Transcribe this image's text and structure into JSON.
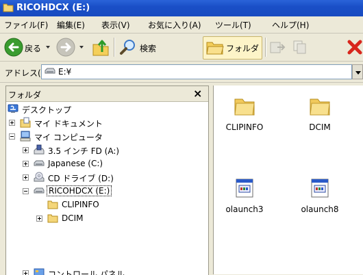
{
  "window": {
    "title": "RICOHDCX (E:)"
  },
  "menu": [
    "ファイル(F)",
    "編集(E)",
    "表示(V)",
    "お気に入り(A)",
    "ツール(T)",
    "ヘルプ(H)"
  ],
  "toolbar": {
    "back": "戻る",
    "search": "検索",
    "folders": "フォルダ"
  },
  "address": {
    "label": "アドレス(D)",
    "value": "E:¥"
  },
  "folder_pane": {
    "title": "フォルダ",
    "close": "×",
    "tree": [
      {
        "label": "デスクトップ",
        "icon": "desktop-icon"
      },
      {
        "label": "マイ ドキュメント",
        "icon": "my-documents-icon",
        "expander": "plus"
      },
      {
        "label": "マイ コンピュータ",
        "icon": "my-computer-icon",
        "expander": "minus"
      },
      {
        "label": "3.5 インチ FD (A:)",
        "icon": "floppy-drive-icon",
        "expander": "plus"
      },
      {
        "label": "Japanese (C:)",
        "icon": "hard-drive-icon",
        "expander": "plus"
      },
      {
        "label": "CD ドライブ (D:)",
        "icon": "cd-drive-icon",
        "expander": "plus"
      },
      {
        "label": "RICOHDCX (E:)",
        "icon": "removable-drive-icon",
        "expander": "minus",
        "selected": true
      },
      {
        "label": "CLIPINFO",
        "icon": "folder-icon"
      },
      {
        "label": "DCIM",
        "icon": "folder-icon",
        "expander": "plus"
      },
      {
        "label": "コントロール パネル",
        "icon": "control-panel-icon",
        "expander": "plus"
      }
    ]
  },
  "files": [
    {
      "name": "CLIPINFO",
      "icon": "folder-icon"
    },
    {
      "name": "DCIM",
      "icon": "folder-icon"
    },
    {
      "name": "olaunch3",
      "icon": "application-icon"
    },
    {
      "name": "olaunch8",
      "icon": "application-icon"
    }
  ]
}
